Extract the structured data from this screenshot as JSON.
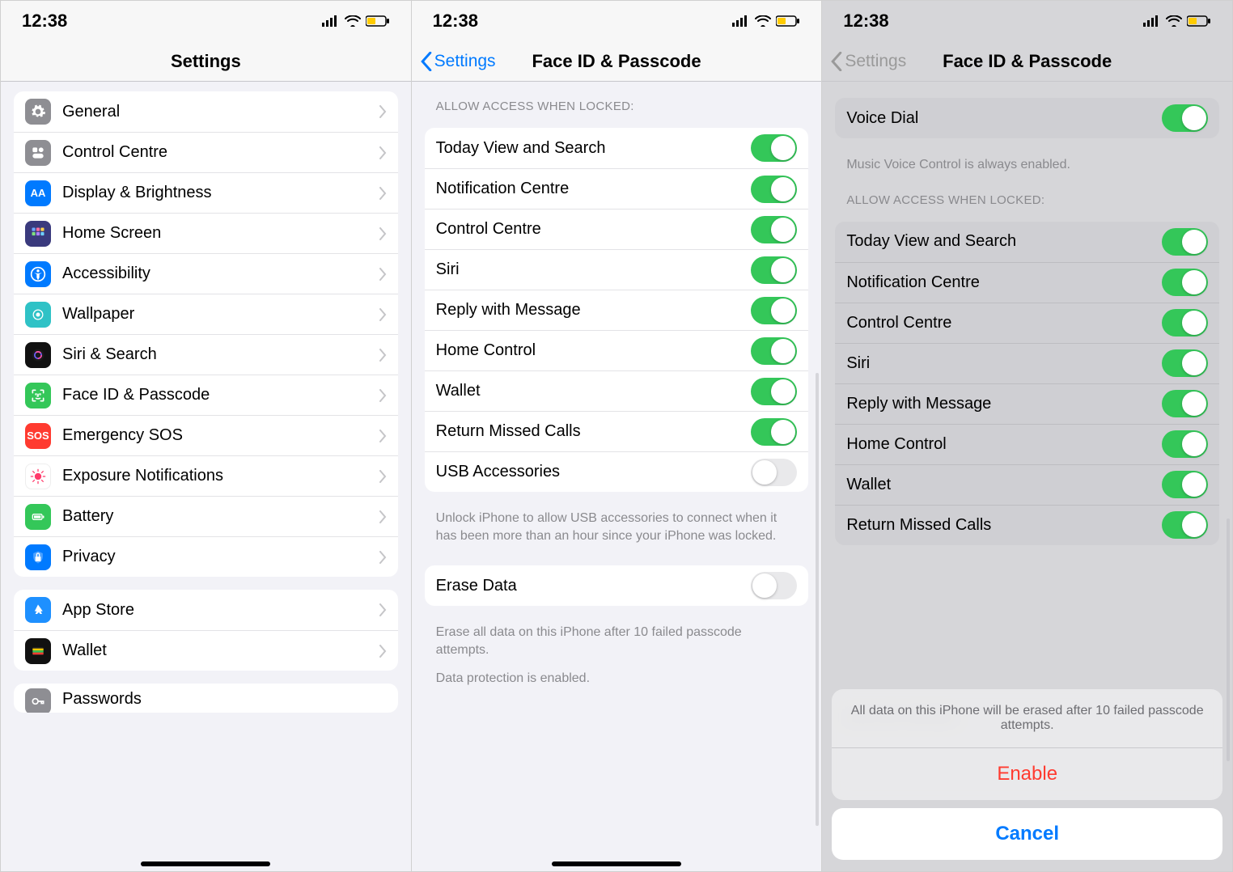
{
  "status": {
    "time": "12:38"
  },
  "phone1": {
    "title": "Settings",
    "group1": [
      {
        "label": "General",
        "icon": "gear"
      },
      {
        "label": "Control Centre",
        "icon": "cc"
      },
      {
        "label": "Display & Brightness",
        "icon": "disp"
      },
      {
        "label": "Home Screen",
        "icon": "home"
      },
      {
        "label": "Accessibility",
        "icon": "access"
      },
      {
        "label": "Wallpaper",
        "icon": "wall"
      },
      {
        "label": "Siri & Search",
        "icon": "siri"
      },
      {
        "label": "Face ID & Passcode",
        "icon": "faceid"
      },
      {
        "label": "Emergency SOS",
        "icon": "sos"
      },
      {
        "label": "Exposure Notifications",
        "icon": "expose"
      },
      {
        "label": "Battery",
        "icon": "battery"
      },
      {
        "label": "Privacy",
        "icon": "privacy"
      }
    ],
    "group2": [
      {
        "label": "App Store",
        "icon": "appstore"
      },
      {
        "label": "Wallet",
        "icon": "wallet"
      }
    ],
    "group3": [
      {
        "label": "Passwords",
        "icon": "pw"
      }
    ]
  },
  "phone2": {
    "back": "Settings",
    "title": "Face ID & Passcode",
    "section_allow": "ALLOW ACCESS WHEN LOCKED:",
    "allow": [
      {
        "label": "Today View and Search",
        "on": true
      },
      {
        "label": "Notification Centre",
        "on": true
      },
      {
        "label": "Control Centre",
        "on": true
      },
      {
        "label": "Siri",
        "on": true
      },
      {
        "label": "Reply with Message",
        "on": true
      },
      {
        "label": "Home Control",
        "on": true
      },
      {
        "label": "Wallet",
        "on": true
      },
      {
        "label": "Return Missed Calls",
        "on": true
      },
      {
        "label": "USB Accessories",
        "on": false
      }
    ],
    "allow_footer": "Unlock iPhone to allow USB accessories to connect when it has been more than an hour since your iPhone was locked.",
    "erase": {
      "label": "Erase Data",
      "on": false
    },
    "erase_footer1": "Erase all data on this iPhone after 10 failed passcode attempts.",
    "erase_footer2": "Data protection is enabled."
  },
  "phone3": {
    "back": "Settings",
    "title": "Face ID & Passcode",
    "voice_dial": {
      "label": "Voice Dial",
      "on": true
    },
    "voice_footer": "Music Voice Control is always enabled.",
    "section_allow": "ALLOW ACCESS WHEN LOCKED:",
    "allow": [
      {
        "label": "Today View and Search",
        "on": true
      },
      {
        "label": "Notification Centre",
        "on": true
      },
      {
        "label": "Control Centre",
        "on": true
      },
      {
        "label": "Siri",
        "on": true
      },
      {
        "label": "Reply with Message",
        "on": true
      },
      {
        "label": "Home Control",
        "on": true
      },
      {
        "label": "Wallet",
        "on": true
      },
      {
        "label": "Return Missed Calls",
        "on": true
      }
    ],
    "sheet": {
      "message": "All data on this iPhone will be erased after 10 failed passcode attempts.",
      "enable": "Enable",
      "cancel": "Cancel"
    },
    "bottom_partial": "passcode attempts."
  }
}
